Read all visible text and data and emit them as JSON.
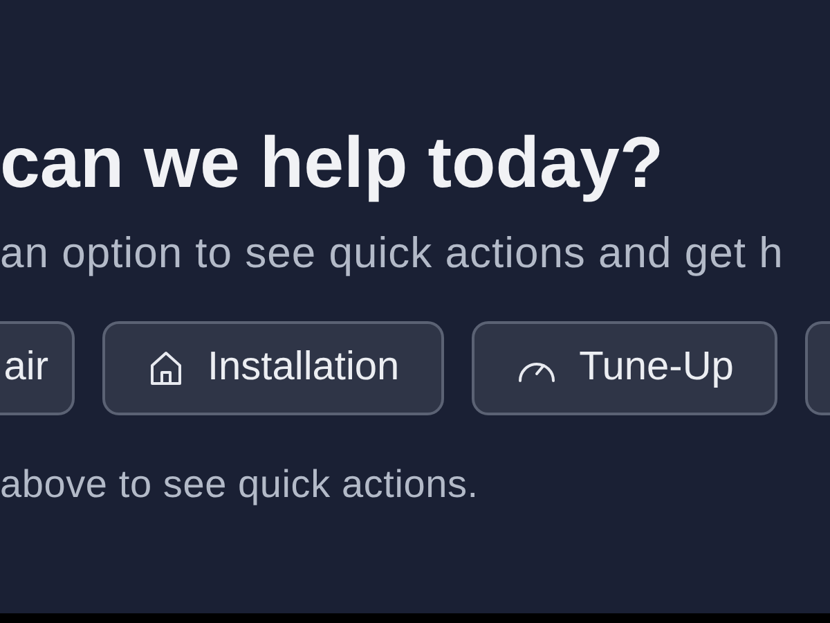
{
  "heading": "can we help today?",
  "subtitle": "an option to see quick actions and get h",
  "options": [
    {
      "kind": "cut-left",
      "label": "air"
    },
    {
      "kind": "house",
      "label": "Installation"
    },
    {
      "kind": "gauge",
      "label": "Tune-Up"
    },
    {
      "kind": "cut-right"
    }
  ],
  "hint": "above to see quick actions."
}
